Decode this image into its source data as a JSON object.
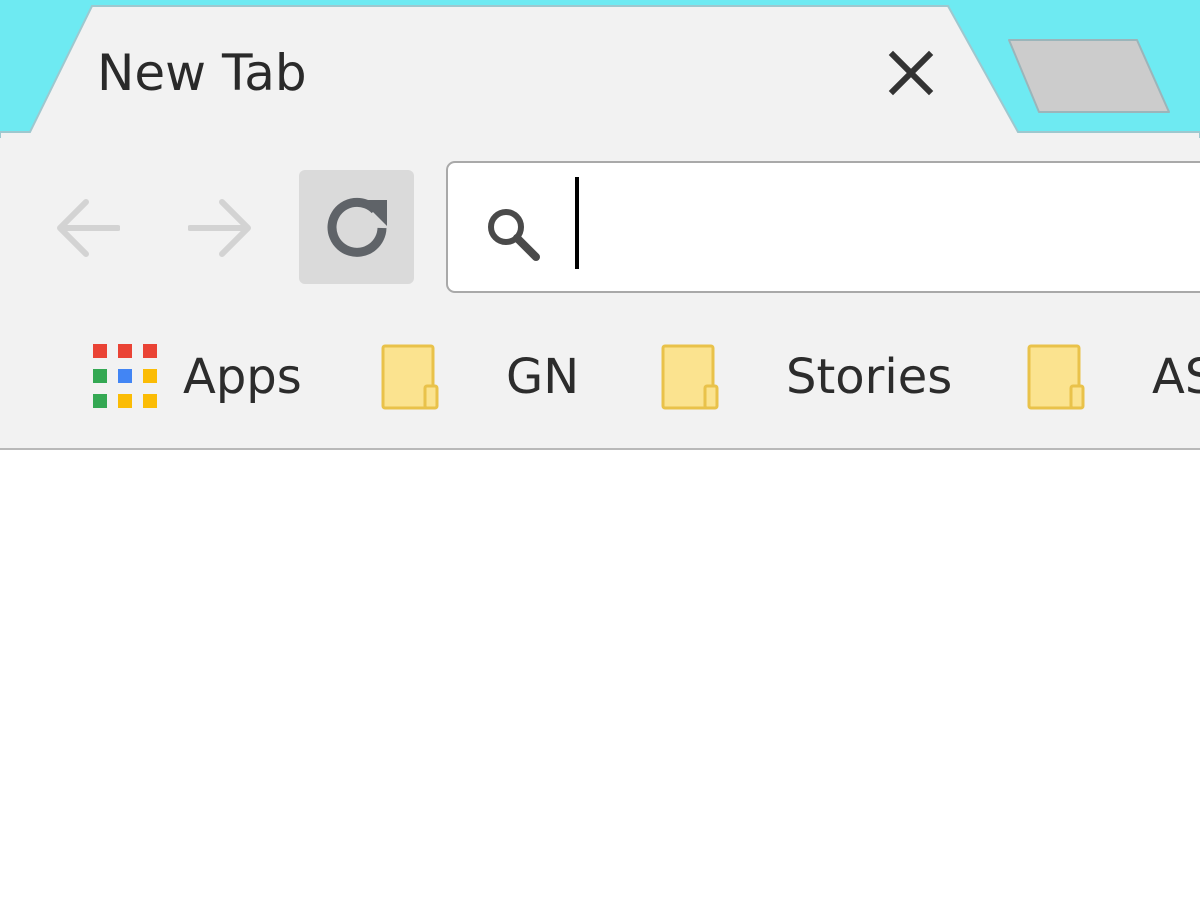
{
  "colors": {
    "tabstrip_bg": "#6eeaf2",
    "tab_bg": "#f2f2f2",
    "toolbar_bg": "#f2f2f2",
    "folder_fill": "#fbe38f",
    "folder_stroke": "#e9c24a",
    "apps_red": "#ea4335",
    "apps_blue": "#4285f4",
    "apps_green": "#34a853",
    "apps_yellow": "#fbbc05"
  },
  "tabs": [
    {
      "label": "New Tab",
      "active": true,
      "close_icon": "close-icon"
    }
  ],
  "toolbar": {
    "back_icon": "arrow-left-icon",
    "forward_icon": "arrow-right-icon",
    "reload_icon": "reload-icon",
    "back_enabled": false,
    "forward_enabled": false
  },
  "omnibox": {
    "icon": "search-icon",
    "value": "",
    "placeholder": ""
  },
  "bookmarks": {
    "items": [
      {
        "label": "Apps",
        "icon": "apps-grid-icon"
      },
      {
        "label": "GN",
        "icon": "folder-icon"
      },
      {
        "label": "Stories",
        "icon": "folder-icon"
      },
      {
        "label": "AS",
        "icon": "folder-icon"
      }
    ]
  }
}
